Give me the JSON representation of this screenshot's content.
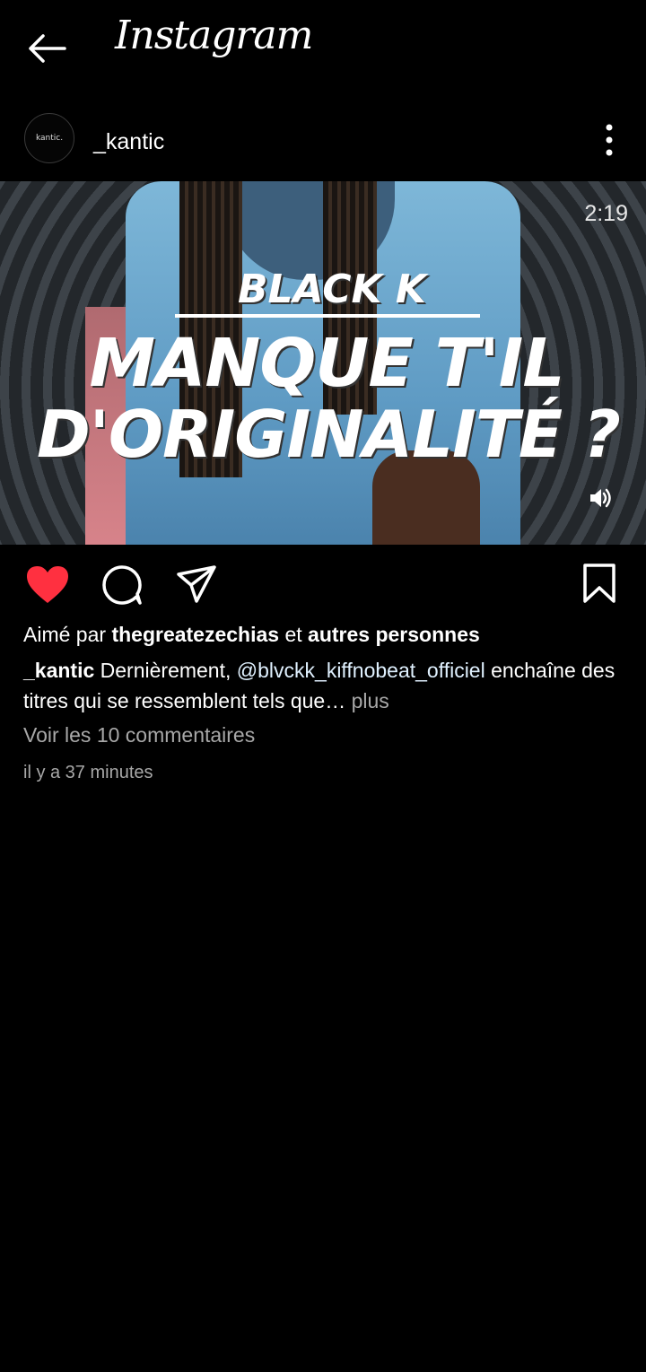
{
  "header": {
    "logo": "Instagram"
  },
  "post": {
    "avatar_text": "kantic.",
    "username": "_kantic",
    "duration": "2:19",
    "overlay": {
      "line1": "BLACK K",
      "line2": "MANQUE T'IL",
      "line3": "D'ORIGINALITÉ ?"
    },
    "liked": true,
    "likes": {
      "prefix": "Aimé par",
      "user": "thegreatezechias",
      "joiner": "et",
      "others": "autres personnes"
    },
    "caption": {
      "user": "_kantic",
      "text_before": "Dernièrement,",
      "mention": "@blvckk_kiffnobeat_officiel",
      "text_after": "enchaîne des titres qui se ressemblent tels que…",
      "more": "plus"
    },
    "comments_link": "Voir les 10 commentaires",
    "time_ago": "il y a 37 minutes"
  },
  "colors": {
    "like_red": "#ff3040",
    "background": "#000000",
    "muted": "#a8a8a8"
  }
}
